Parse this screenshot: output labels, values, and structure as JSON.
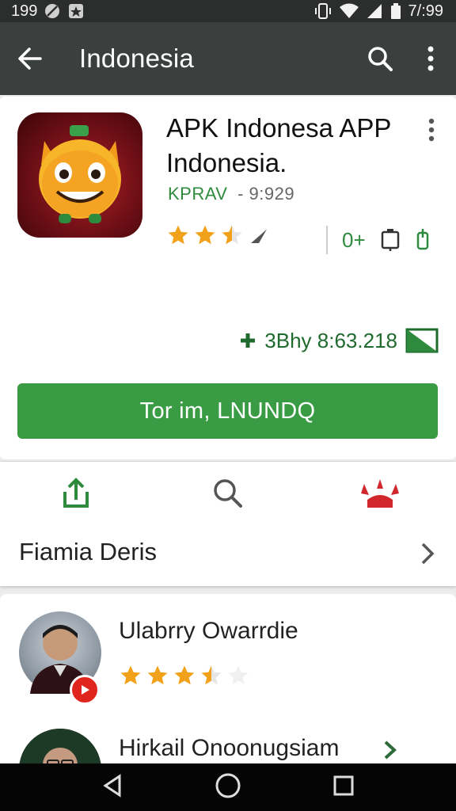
{
  "status_bar": {
    "time_left": "199",
    "time_right": "7/:99"
  },
  "app_bar": {
    "title": "Indonesia"
  },
  "app": {
    "name": "APK Indonesa APP Indonesia.",
    "developer": "KPRAV",
    "developer_meta": "- 9:929",
    "rating_stars": 2.5,
    "age_rating": "0+",
    "download_stat": "3Bhy 8:63.218",
    "install_label": "Tor im, LNUNDQ"
  },
  "actions": {
    "row_label": "Fiamia Deris"
  },
  "reviews": [
    {
      "name": "Ulabrry Owarrdie",
      "stars": 3.5
    },
    {
      "name": "Hirkail Onoonugsiam"
    }
  ],
  "colors": {
    "accent_green": "#3a9b45",
    "app_bar": "#3b3f3d",
    "star": "#f2a21a"
  }
}
